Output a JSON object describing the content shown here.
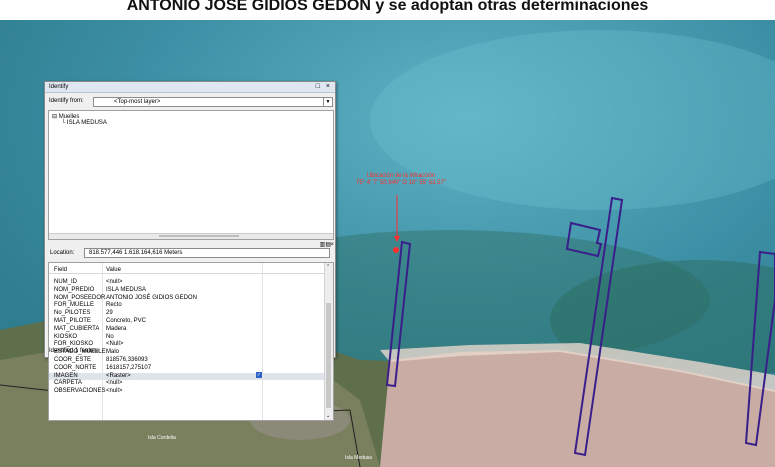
{
  "banner": {
    "text": "ANTONIO JOSÉ GIDIOS GEDON y se adoptan otras determinaciones"
  },
  "map": {
    "annotation": {
      "line1": "Ubicación de la infracción",
      "line2": "75° 4' 7\" 50.940\" O 10° 55' 53.57\""
    },
    "labels": {
      "road_a": "Isla Cordelia",
      "road_b": "Isla Medusa"
    }
  },
  "window": {
    "title": "Identify",
    "controls": "□ ×",
    "identify_from_label": "Identify from:",
    "identify_from_value": "<Top-most layer>",
    "tree": {
      "layer": "Muelles",
      "feature": "ISLA MEDUSA"
    },
    "location_label": "Location:",
    "location_value": "818.577,446  1.618.164,616 Meters",
    "grid": {
      "col_field": "Field",
      "col_value": "Value",
      "rows": [
        {
          "field": "NUM_ID",
          "value": "<null>"
        },
        {
          "field": "NOM_PREDIO",
          "value": "ISLA MEDUSA"
        },
        {
          "field": "NOM_POSEEDOR",
          "value": "ANTONIO JOSÉ GIDIOS GEDON"
        },
        {
          "field": "FOR_MUELLE",
          "value": "Recto"
        },
        {
          "field": "No_PILOTES",
          "value": "29"
        },
        {
          "field": "MAT_PILOTE",
          "value": "Concreto, PVC"
        },
        {
          "field": "MAT_CUBIERTA",
          "value": "Madera"
        },
        {
          "field": "KIOSKO",
          "value": "No"
        },
        {
          "field": "FOR_KIOSKO",
          "value": "<Null>"
        },
        {
          "field": "ESTADO_MUELLE",
          "value": "Malo"
        },
        {
          "field": "COOR_ESTE",
          "value": "818576,336093"
        },
        {
          "field": "COOR_NORTE",
          "value": "1618157,275107"
        },
        {
          "field": "IMAGEN",
          "value": "<Raster>"
        },
        {
          "field": "CARPETA",
          "value": "<null>"
        },
        {
          "field": "OBSERVACIONES",
          "value": "<null>"
        }
      ]
    },
    "status": "Identified 1 feature"
  },
  "colors": {
    "sea": "#3b8fa3",
    "pier_outline": "#3a1f8a",
    "annotation": "#ff2d2d",
    "sand": "#c9ada4"
  }
}
